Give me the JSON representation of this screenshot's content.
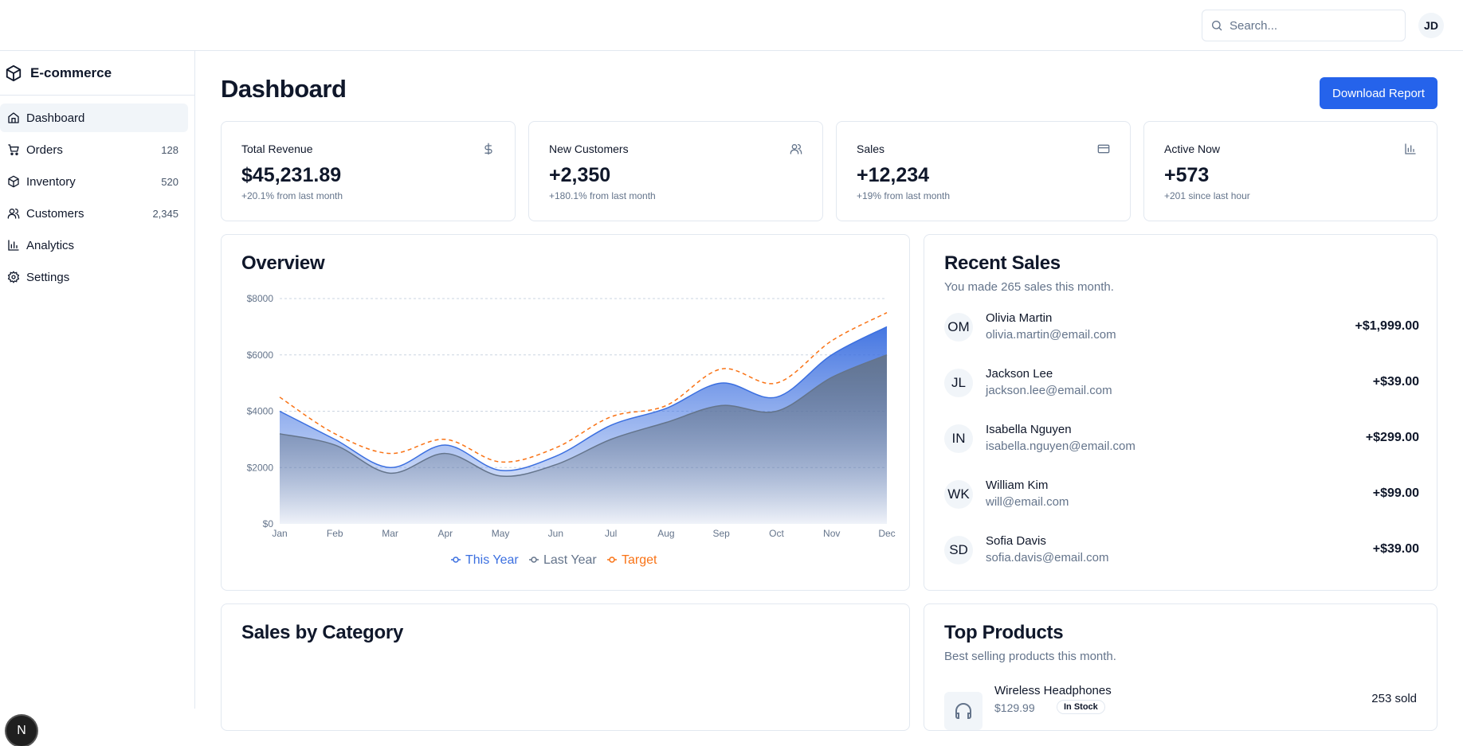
{
  "header": {
    "search_placeholder": "Search...",
    "user_initials": "JD"
  },
  "sidebar": {
    "brand": "E-commerce",
    "items": [
      {
        "label": "Dashboard",
        "count": "",
        "icon": "home-icon",
        "active": true
      },
      {
        "label": "Orders",
        "count": "128",
        "icon": "cart-icon"
      },
      {
        "label": "Inventory",
        "count": "520",
        "icon": "package-icon"
      },
      {
        "label": "Customers",
        "count": "2,345",
        "icon": "users-icon"
      },
      {
        "label": "Analytics",
        "count": "",
        "icon": "bar-chart-icon"
      },
      {
        "label": "Settings",
        "count": "",
        "icon": "gear-icon"
      }
    ],
    "bottom_badge": "N"
  },
  "main": {
    "title": "Dashboard",
    "download_label": "Download Report",
    "stats": [
      {
        "title": "Total Revenue",
        "value": "$45,231.89",
        "sub": "+20.1% from last month",
        "icon": "dollar-icon"
      },
      {
        "title": "New Customers",
        "value": "+2,350",
        "sub": "+180.1% from last month",
        "icon": "users-icon"
      },
      {
        "title": "Sales",
        "value": "+12,234",
        "sub": "+19% from last month",
        "icon": "credit-card-icon"
      },
      {
        "title": "Active Now",
        "value": "+573",
        "sub": "+201 since last hour",
        "icon": "bar-chart-icon"
      }
    ],
    "overview": {
      "title": "Overview"
    },
    "recent_sales": {
      "title": "Recent Sales",
      "description": "You made 265 sales this month.",
      "items": [
        {
          "initials": "OM",
          "name": "Olivia Martin",
          "email": "olivia.martin@email.com",
          "amount": "+$1,999.00"
        },
        {
          "initials": "JL",
          "name": "Jackson Lee",
          "email": "jackson.lee@email.com",
          "amount": "+$39.00"
        },
        {
          "initials": "IN",
          "name": "Isabella Nguyen",
          "email": "isabella.nguyen@email.com",
          "amount": "+$299.00"
        },
        {
          "initials": "WK",
          "name": "William Kim",
          "email": "will@email.com",
          "amount": "+$99.00"
        },
        {
          "initials": "SD",
          "name": "Sofia Davis",
          "email": "sofia.davis@email.com",
          "amount": "+$39.00"
        }
      ]
    },
    "sales_by_category": {
      "title": "Sales by Category"
    },
    "top_products": {
      "title": "Top Products",
      "description": "Best selling products this month.",
      "items": [
        {
          "name": "Wireless Headphones",
          "price": "$129.99",
          "badge": "In Stock",
          "sold": "253 sold",
          "icon": "headphones-icon"
        }
      ]
    }
  },
  "colors": {
    "accent": "#2563eb",
    "this_year": "#3b6fe0",
    "last_year": "#64748b",
    "target": "#f97316"
  },
  "chart_data": {
    "type": "area",
    "categories": [
      "Jan",
      "Feb",
      "Mar",
      "Apr",
      "May",
      "Jun",
      "Jul",
      "Aug",
      "Sep",
      "Oct",
      "Nov",
      "Dec"
    ],
    "series": [
      {
        "name": "This Year",
        "values": [
          4000,
          3000,
          2000,
          2800,
          1900,
          2400,
          3500,
          4100,
          5000,
          4500,
          6000,
          7000
        ]
      },
      {
        "name": "Last Year",
        "values": [
          3200,
          2800,
          1800,
          2500,
          1700,
          2100,
          3000,
          3600,
          4200,
          4000,
          5200,
          6000
        ]
      },
      {
        "name": "Target",
        "values": [
          4500,
          3200,
          2500,
          3000,
          2200,
          2700,
          3800,
          4200,
          5500,
          5000,
          6500,
          7500
        ]
      }
    ],
    "yticks": [
      "$0",
      "$2000",
      "$4000",
      "$6000",
      "$8000"
    ],
    "ylim": [
      0,
      8000
    ],
    "grid": true,
    "legend": "bottom-center"
  }
}
